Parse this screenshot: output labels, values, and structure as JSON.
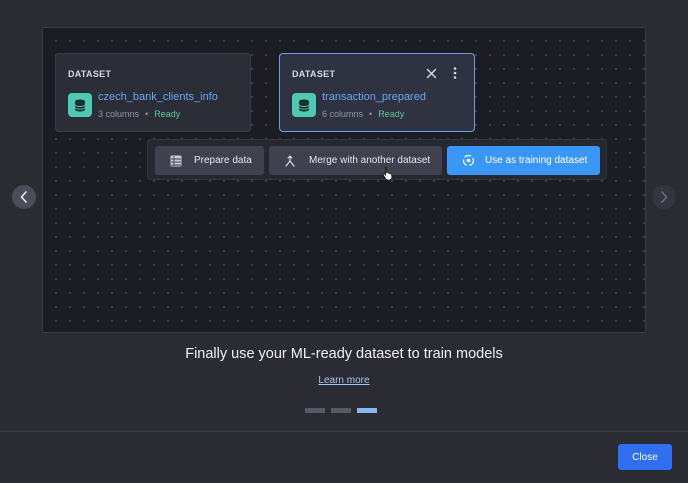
{
  "canvas": {
    "cards": [
      {
        "type": "DATASET",
        "name": "czech_bank_clients_info",
        "columns": "3 columns",
        "status": "Ready",
        "icon": "database-icon"
      },
      {
        "type": "DATASET",
        "name": "transaction_prepared",
        "columns": "6 columns",
        "status": "Ready",
        "icon": "database-icon",
        "selected": true
      }
    ],
    "actions": {
      "prepare": "Prepare data",
      "merge": "Merge with another dataset",
      "train": "Use as training dataset"
    }
  },
  "caption": "Finally use your ML-ready dataset to train models",
  "learn_more": "Learn more",
  "pagination": {
    "total": 3,
    "active": 3
  },
  "footer": {
    "close_label": "Close"
  },
  "colors": {
    "accent": "#3a97f5",
    "dataset_icon": "#4fc9b2",
    "ready": "#5ec49a",
    "close_button": "#2f6ff0"
  }
}
